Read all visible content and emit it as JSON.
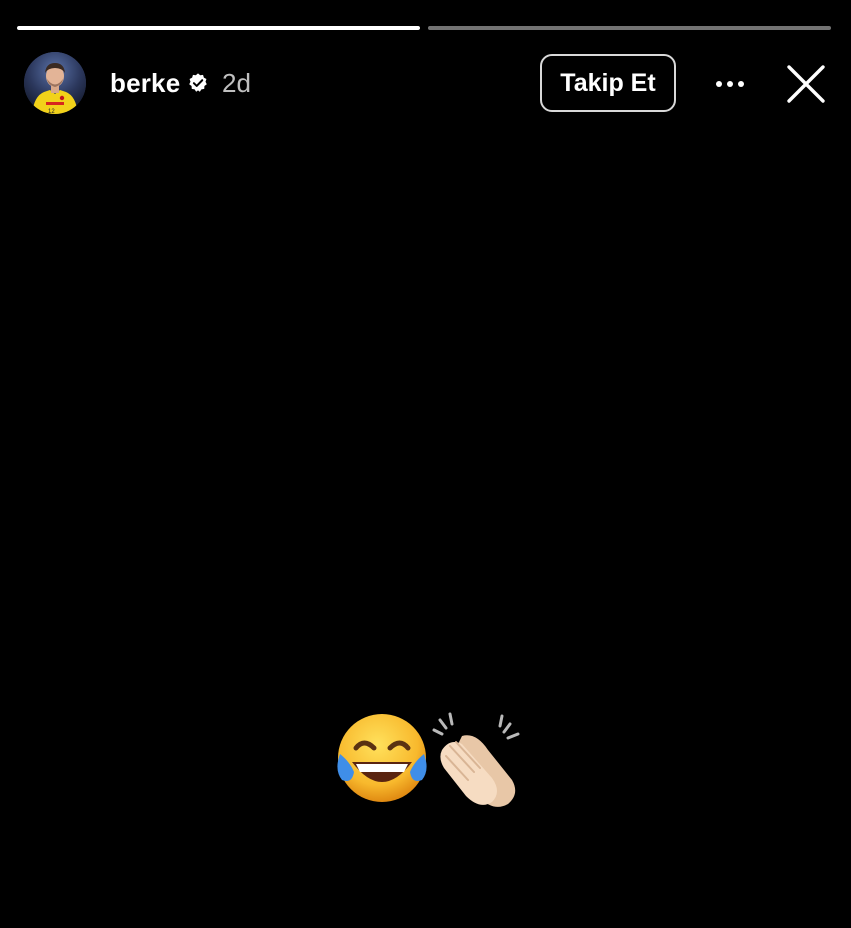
{
  "story": {
    "progress": [
      {
        "fraction": 1.0
      },
      {
        "fraction": 0.0
      }
    ]
  },
  "header": {
    "username": "berke",
    "verified": true,
    "timestamp": "2d",
    "follow_label": "Takip Et",
    "avatar_icon": "avatar-goalkeeper-icon",
    "more_icon": "more-horizontal-icon",
    "close_icon": "close-icon"
  },
  "content": {
    "emojis": [
      "😂",
      "👏🏻"
    ]
  }
}
